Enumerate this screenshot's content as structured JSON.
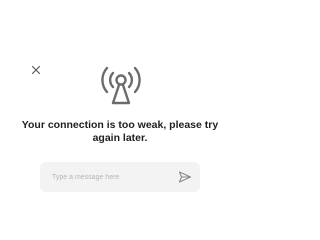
{
  "dialog": {
    "close_icon": "close-icon",
    "status_icon": "antenna-signal-icon",
    "message": "Your connection is too weak, please try again later."
  },
  "composer": {
    "placeholder": "Type a message here",
    "value": "",
    "send_icon": "send-icon"
  },
  "colors": {
    "background": "#ffffff",
    "text": "#1f1f1f",
    "icon": "#6b6b6b",
    "input_background": "#f3f3f4",
    "placeholder": "#b5b5b8"
  }
}
